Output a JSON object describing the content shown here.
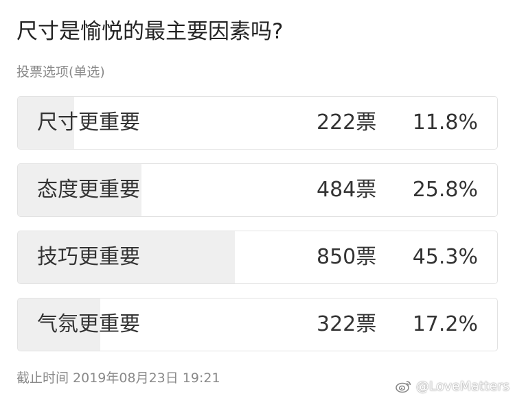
{
  "poll": {
    "title": "尺寸是愉悦的最主要因素吗?",
    "subtitle": "投票选项(单选)",
    "options": [
      {
        "label": "尺寸更重要",
        "votes": "222票",
        "percent": "11.8%",
        "fraction": 0.118
      },
      {
        "label": "态度更重要",
        "votes": "484票",
        "percent": "25.8%",
        "fraction": 0.258
      },
      {
        "label": "技巧更重要",
        "votes": "850票",
        "percent": "45.3%",
        "fraction": 0.453
      },
      {
        "label": "气氛更重要",
        "votes": "322票",
        "percent": "17.2%",
        "fraction": 0.172
      }
    ],
    "deadline": "截止时间 2019年08月23日 19:21"
  },
  "watermark": {
    "text": "@LoveMatters",
    "icon": "weibo-logo-icon"
  },
  "colors": {
    "bar_fill": "#efefef",
    "border": "#e2e2e2",
    "muted_text": "#8a8a8a"
  }
}
